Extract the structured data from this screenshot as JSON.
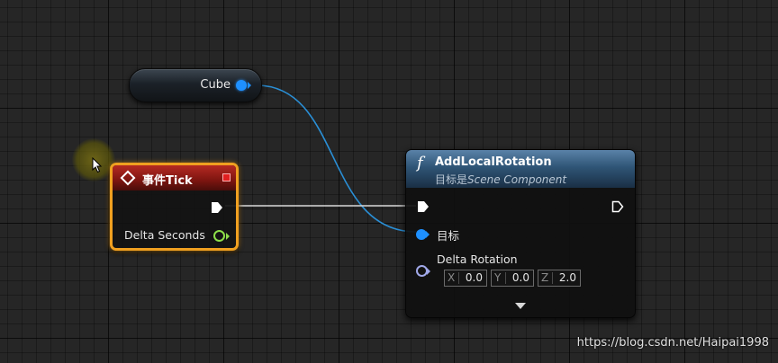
{
  "graph": {
    "background": "#262626"
  },
  "variable_node": {
    "label": "Cube",
    "pin_color": "#1e90ff"
  },
  "event_node": {
    "title": "事件Tick",
    "header_color": "#b52a22",
    "border_color": "#f0a020",
    "delta_seconds_label": "Delta Seconds",
    "delta_seconds_pin_color": "#8ee04a",
    "icon": "event-diamond-icon"
  },
  "function_node": {
    "title": "AddLocalRotation",
    "subtitle_prefix": "目标是",
    "subtitle_class": "Scene Component",
    "header_color": "#2f5576",
    "icon": "function-icon",
    "icon_glyph": "f",
    "target_label": "目标",
    "delta_rotation_label": "Delta Rotation",
    "rotation": {
      "x": {
        "axis": "X",
        "value": "0.0"
      },
      "y": {
        "axis": "Y",
        "value": "0.0"
      },
      "z": {
        "axis": "Z",
        "value": "2.0"
      }
    }
  },
  "wires": {
    "object_wire_color": "#2a8fd6",
    "exec_wire_color": "#d8d8d8"
  },
  "watermark": "https://blog.csdn.net/Haipai1998"
}
